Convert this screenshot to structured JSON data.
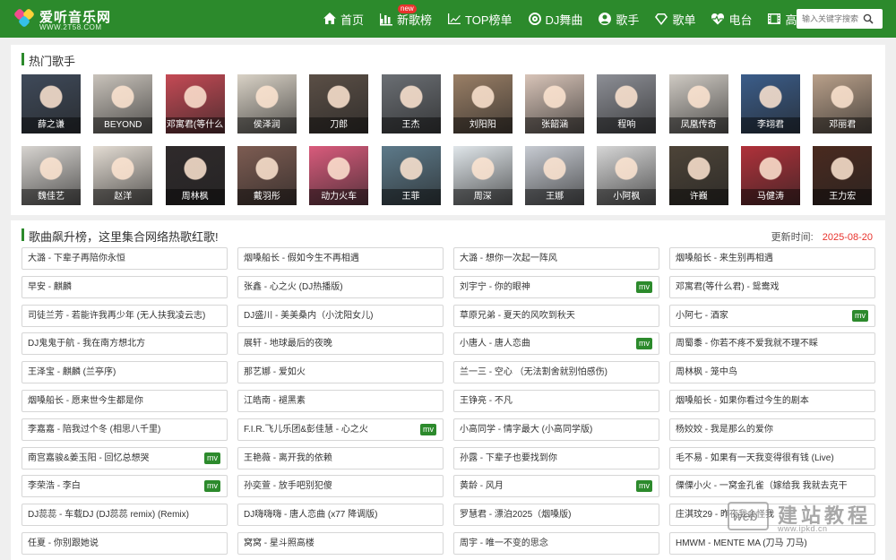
{
  "header": {
    "logo_title": "爱听音乐网",
    "logo_sub": "WWW.2T58.COM",
    "nav": [
      {
        "label": "首页",
        "icon": "home-icon"
      },
      {
        "label": "新歌榜",
        "icon": "chart-icon",
        "badge": "new"
      },
      {
        "label": "TOP榜单",
        "icon": "trend-icon"
      },
      {
        "label": "DJ舞曲",
        "icon": "disc-icon"
      },
      {
        "label": "歌手",
        "icon": "user-icon"
      },
      {
        "label": "歌单",
        "icon": "diamond-icon"
      },
      {
        "label": "电台",
        "icon": "heart-pulse-icon"
      },
      {
        "label": "高清MV",
        "icon": "film-icon"
      }
    ],
    "search_placeholder": "输入关键字搜索"
  },
  "singers_section": {
    "title": "热门歌手",
    "singers": [
      {
        "name": "薛之谦",
        "color": "#3f4a5a"
      },
      {
        "name": "BEYOND",
        "color": "#c9c3bb"
      },
      {
        "name": "邓寓君(等什么",
        "color": "#c54a55"
      },
      {
        "name": "侯泽润",
        "color": "#d9d2c6"
      },
      {
        "name": "刀郎",
        "color": "#5b4f46"
      },
      {
        "name": "王杰",
        "color": "#6b6f74"
      },
      {
        "name": "刘阳阳",
        "color": "#9a7f66"
      },
      {
        "name": "张韶涵",
        "color": "#d8c4b8"
      },
      {
        "name": "程响",
        "color": "#8d8f96"
      },
      {
        "name": "凤凰传奇",
        "color": "#cfcac3"
      },
      {
        "name": "李翊君",
        "color": "#3b5d8a"
      },
      {
        "name": "邓丽君",
        "color": "#b9a08a"
      },
      {
        "name": "魏佳艺",
        "color": "#d7d4d0"
      },
      {
        "name": "赵洋",
        "color": "#e3dcd3"
      },
      {
        "name": "周林枫",
        "color": "#2f2a2b"
      },
      {
        "name": "戴羽彤",
        "color": "#7d5c52"
      },
      {
        "name": "动力火车",
        "color": "#d95b7c"
      },
      {
        "name": "王菲",
        "color": "#5d7a8a"
      },
      {
        "name": "周深",
        "color": "#e0e6ea"
      },
      {
        "name": "王娜",
        "color": "#c7cbd2"
      },
      {
        "name": "小阿枫",
        "color": "#d6d6d6"
      },
      {
        "name": "许巍",
        "color": "#4d4438"
      },
      {
        "name": "马健涛",
        "color": "#b0313a"
      },
      {
        "name": "王力宏",
        "color": "#4a2a1f"
      }
    ]
  },
  "songs_section": {
    "title": "歌曲飙升榜，这里集合网络热歌红歌!",
    "update_label": "更新时间:",
    "update_date": "2025-08-20",
    "mv_label": "mv",
    "songs": [
      {
        "title": "大潞 - 下辈子再陪你永恒",
        "mv": false
      },
      {
        "title": "烟嗓船长 - 假如今生不再相遇",
        "mv": false
      },
      {
        "title": "大潞 - 想你一次起一阵风",
        "mv": false
      },
      {
        "title": "烟嗓船长 - 来生别再相遇",
        "mv": false
      },
      {
        "title": "早安 - 麒麟",
        "mv": false
      },
      {
        "title": "张鑫 - 心之火 (DJ热播版)",
        "mv": false
      },
      {
        "title": "刘宇宁 - 你的眼神",
        "mv": true
      },
      {
        "title": "邓寓君(等什么君) - 鸳鸯戏",
        "mv": false
      },
      {
        "title": "司徒兰芳 - 若能许我再少年 (无人扶我凌云志)",
        "mv": false
      },
      {
        "title": "DJ盛川 - 美美桑内（小沈阳女儿)",
        "mv": false
      },
      {
        "title": "草原兄弟 - 夏天的风吹到秋天",
        "mv": false
      },
      {
        "title": "小阿七 - 酒家",
        "mv": true
      },
      {
        "title": "DJ鬼鬼于航 - 我在南方想北方",
        "mv": false
      },
      {
        "title": "展轩 - 地球最后的夜晚",
        "mv": false
      },
      {
        "title": "小唐人 - 唐人恋曲",
        "mv": true
      },
      {
        "title": "周蜀黍 - 你若不疼不爱我就不理不睬",
        "mv": false
      },
      {
        "title": "王泽宝 - 麒麟 (兰亭序)",
        "mv": false
      },
      {
        "title": "那艺娜 - 爱如火",
        "mv": false
      },
      {
        "title": "兰一三 - 空心 （无法割舍就别怕感伤)",
        "mv": false
      },
      {
        "title": "周林枫 - 笼中鸟",
        "mv": false
      },
      {
        "title": "烟嗓船长 - 愿来世今生都是你",
        "mv": false
      },
      {
        "title": "江皓南 - 褪黑素",
        "mv": false
      },
      {
        "title": "王铮亮 - 不凡",
        "mv": false
      },
      {
        "title": "烟嗓船长 - 如果你看过今生的剧本",
        "mv": false
      },
      {
        "title": "李嘉嘉 - 陪我过个冬 (相思八千里)",
        "mv": false
      },
      {
        "title": "F.I.R.飞儿乐团&彭佳慧 - 心之火",
        "mv": true
      },
      {
        "title": "小高同学 - 情字最大 (小高同学版)",
        "mv": false
      },
      {
        "title": "杨姣姣 - 我是那么的爱你",
        "mv": false
      },
      {
        "title": "南宫嘉骏&姜玉阳 - 回忆总想哭",
        "mv": true
      },
      {
        "title": "王艳薇 - 离开我的依赖",
        "mv": false
      },
      {
        "title": "孙露 - 下辈子也要找到你",
        "mv": false
      },
      {
        "title": "毛不易 - 如果有一天我变得很有钱 (Live)",
        "mv": false
      },
      {
        "title": "李荣浩 - 李白",
        "mv": true
      },
      {
        "title": "孙奕萱 - 放手吧别犯傻",
        "mv": false
      },
      {
        "title": "黄龄 - 风月",
        "mv": true
      },
      {
        "title": "傈傈小火 - 一窝金孔雀（嫁给我 我就去克干",
        "mv": false
      },
      {
        "title": "DJ蕊蕊 - 车载DJ (DJ蕊蕊 remix) (Remix)",
        "mv": false
      },
      {
        "title": "DJ嗨嗨嗨 - 唐人恋曲 (x77 降调版)",
        "mv": false
      },
      {
        "title": "罗慧君 - 漂泊2025（烟嗓版)",
        "mv": false
      },
      {
        "title": "庄淇玟29 - 昨夜我会怪我",
        "mv": false
      },
      {
        "title": "任夏 - 你别跟她说",
        "mv": false
      },
      {
        "title": "窝窝 - 星斗照高楼",
        "mv": false
      },
      {
        "title": "周宇 - 唯一不变的思念",
        "mv": false
      },
      {
        "title": "HMWM - MENTE MA (刀马 刀马)",
        "mv": false
      }
    ]
  },
  "watermark": {
    "box_text": "web",
    "cn_text": "建站教程",
    "url": "www.ipkd.cn"
  },
  "colors": {
    "brand_green": "#2c8a2c",
    "date_red": "#e8322c"
  }
}
